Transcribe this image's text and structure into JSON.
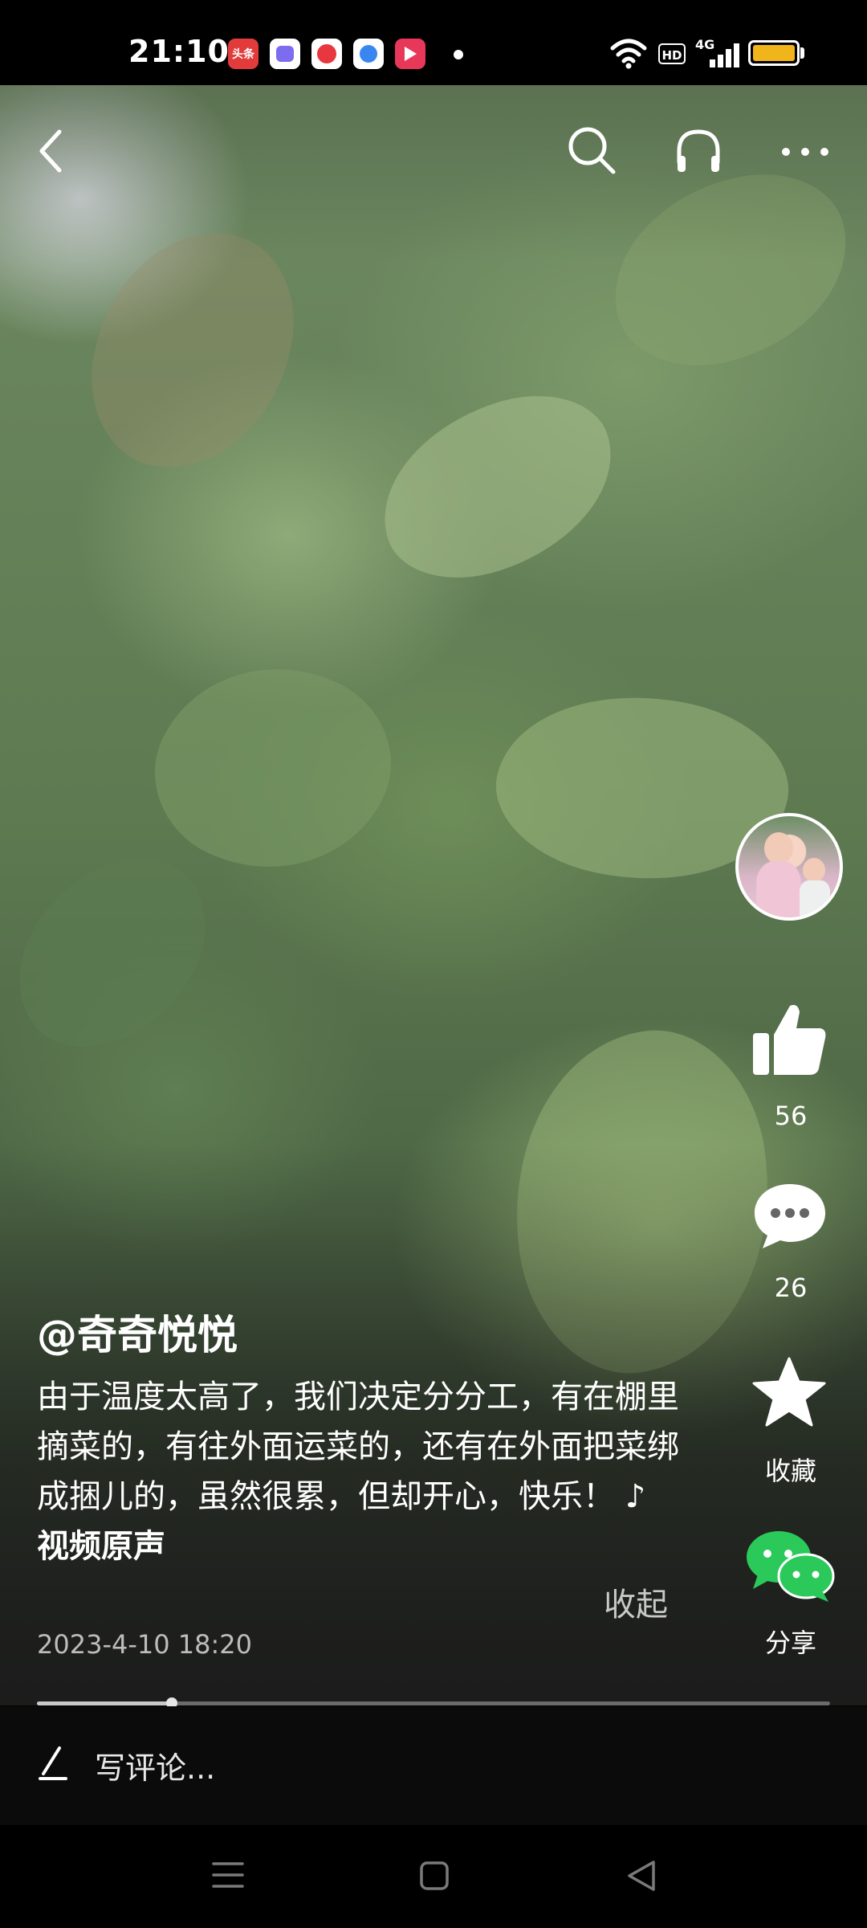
{
  "status_bar": {
    "time": "21:10",
    "notifications": [
      {
        "name": "toutiao-icon",
        "label": "头条",
        "color": "#e23b3b"
      },
      {
        "name": "app-purple-icon",
        "label": "",
        "color": "#7b6cf0"
      },
      {
        "name": "app-red-icon",
        "label": "",
        "color": "#e9373f"
      },
      {
        "name": "app-blue-icon",
        "label": "",
        "color": "#3a86f0"
      },
      {
        "name": "video-app-icon",
        "label": "",
        "color": "#e8385a"
      }
    ],
    "network_hd": "HD",
    "network_type": "4G",
    "battery_color": "#f0b51a"
  },
  "top_bar": {
    "back_icon": "chevron-left-icon",
    "search_icon": "search-icon",
    "headphones_icon": "headphones-icon",
    "more_icon": "more-dots-icon"
  },
  "actions": {
    "like_count": "56",
    "comment_count": "26",
    "favorite_label": "收藏",
    "share_label": "分享",
    "share_color": "#2ac95a"
  },
  "post": {
    "author": "@奇奇悦悦",
    "caption": "由于温度太高了，我们决定分分工，有在棚里摘菜的，有往外面运菜的，还有在外面把菜绑成捆儿的，虽然很累，但却开心，快乐！",
    "music_symbol": "♪",
    "music_label": "视频原声",
    "collapse_label": "收起",
    "date": "2023-4-10 18:20"
  },
  "playback": {
    "progress": 0.17
  },
  "comment": {
    "placeholder": "写评论..."
  }
}
